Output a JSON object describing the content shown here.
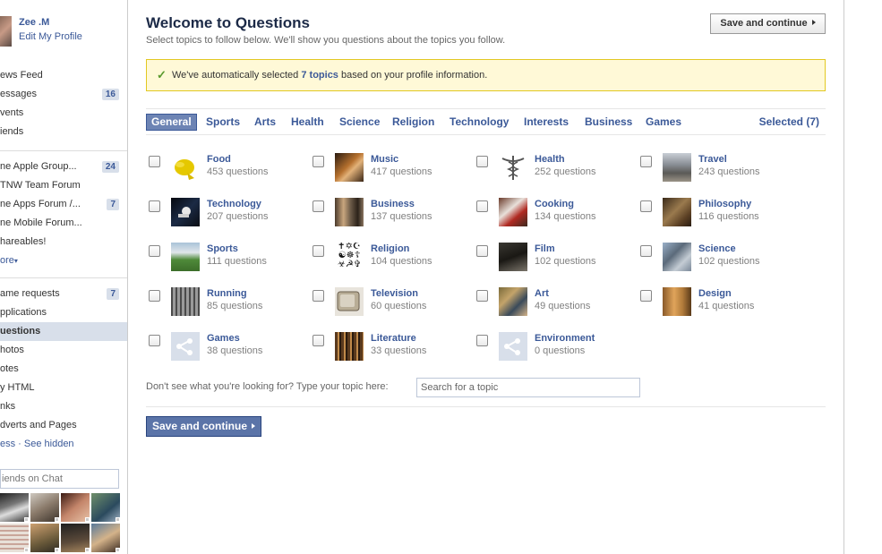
{
  "profile": {
    "name": "Zee .M",
    "edit_label": "Edit My Profile"
  },
  "sidebar": {
    "nav": [
      {
        "label": "ews Feed",
        "count": ""
      },
      {
        "label": "essages",
        "count": "16"
      },
      {
        "label": "vents",
        "count": ""
      },
      {
        "label": "iends",
        "count": ""
      }
    ],
    "groups": [
      {
        "label": "ne Apple Group...",
        "count": "24"
      },
      {
        "label": "TNW Team Forum",
        "count": ""
      },
      {
        "label": "ne Apps Forum  /...",
        "count": "7"
      },
      {
        "label": "ne Mobile Forum...",
        "count": ""
      },
      {
        "label": "hareables!",
        "count": ""
      },
      {
        "label": "ore",
        "count": ""
      }
    ],
    "apps": [
      {
        "label": "ame requests",
        "count": "7"
      },
      {
        "label": "pplications",
        "count": ""
      },
      {
        "label": "uestions",
        "count": ""
      },
      {
        "label": "hotos",
        "count": ""
      },
      {
        "label": "otes",
        "count": ""
      },
      {
        "label": "y HTML",
        "count": ""
      },
      {
        "label": "nks",
        "count": ""
      },
      {
        "label": "dverts and Pages",
        "count": ""
      },
      {
        "label": "ess · See hidden",
        "count": ""
      }
    ],
    "chat_label": "iends on Chat"
  },
  "main": {
    "title": "Welcome to Questions",
    "subtitle": "Select topics to follow below. We'll show you questions about the topics you follow.",
    "save_top": "Save and continue",
    "notice": {
      "before": "We've automatically selected ",
      "highlight": "7 topics",
      "after": " based on your profile information."
    },
    "tabs": [
      "General",
      "Sports",
      "Arts",
      "Health",
      "Science",
      "Religion",
      "Technology",
      "Interests",
      "Business",
      "Games"
    ],
    "selected_label": "Selected (7)",
    "topics": [
      {
        "name": "Food",
        "count": "453 questions",
        "icon": "food-thumb"
      },
      {
        "name": "Music",
        "count": "417 questions",
        "icon": "music-thumb"
      },
      {
        "name": "Health",
        "count": "252 questions",
        "icon": "health-thumb"
      },
      {
        "name": "Travel",
        "count": "243 questions",
        "icon": "travel-thumb"
      },
      {
        "name": "Technology",
        "count": "207 questions",
        "icon": "technology-thumb"
      },
      {
        "name": "Business",
        "count": "137 questions",
        "icon": "business-thumb"
      },
      {
        "name": "Cooking",
        "count": "134 questions",
        "icon": "cooking-thumb"
      },
      {
        "name": "Philosophy",
        "count": "116 questions",
        "icon": "philosophy-thumb"
      },
      {
        "name": "Sports",
        "count": "111 questions",
        "icon": "sports-thumb"
      },
      {
        "name": "Religion",
        "count": "104 questions",
        "icon": "religion-thumb"
      },
      {
        "name": "Film",
        "count": "102 questions",
        "icon": "film-thumb"
      },
      {
        "name": "Science",
        "count": "102 questions",
        "icon": "science-thumb"
      },
      {
        "name": "Running",
        "count": "85 questions",
        "icon": "running-thumb"
      },
      {
        "name": "Television",
        "count": "60 questions",
        "icon": "television-thumb"
      },
      {
        "name": "Art",
        "count": "49 questions",
        "icon": "art-thumb"
      },
      {
        "name": "Design",
        "count": "41 questions",
        "icon": "design-thumb"
      },
      {
        "name": "Games",
        "count": "38 questions",
        "icon": "games-thumb"
      },
      {
        "name": "Literature",
        "count": "33 questions",
        "icon": "literature-thumb"
      },
      {
        "name": "Environment",
        "count": "0 questions",
        "icon": "environment-thumb"
      }
    ],
    "search": {
      "label": "Don't see what you're looking for? Type your topic here:",
      "placeholder": "Search for a topic"
    },
    "save_bottom": "Save and continue"
  },
  "colors": {
    "link": "#3b5998",
    "notice_bg": "#fff9d7",
    "notice_border": "#e2c822",
    "badge_bg": "#d8dfea"
  }
}
